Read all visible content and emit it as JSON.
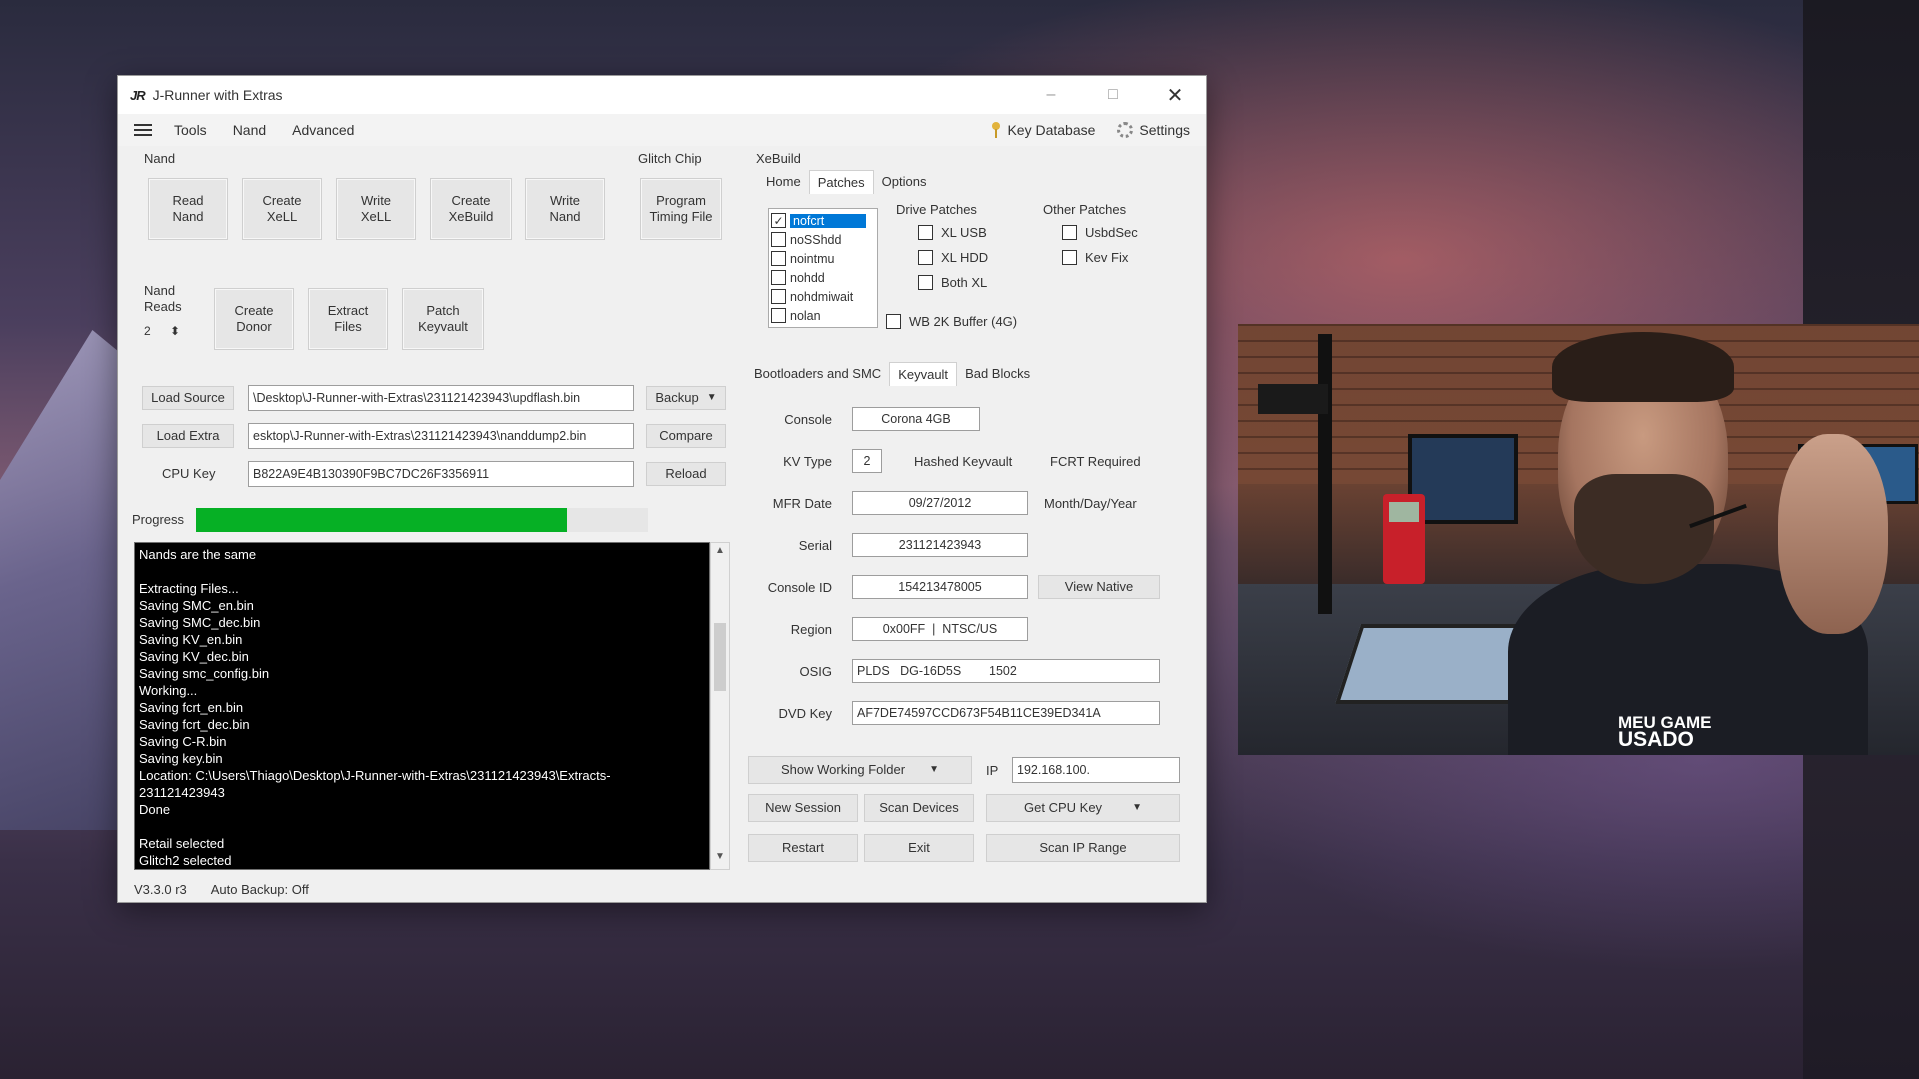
{
  "window": {
    "logo": "JR",
    "title": "J-Runner with Extras",
    "controls": [
      "–",
      "□",
      "✕"
    ]
  },
  "menu": {
    "items": [
      "Tools",
      "Nand",
      "Advanced"
    ],
    "key_database": "Key Database",
    "settings": "Settings"
  },
  "nand": {
    "group_label": "Nand",
    "buttons": [
      "Read\nNand",
      "Create\nXeLL",
      "Write\nXeLL",
      "Create\nXeBuild",
      "Write\nNand"
    ],
    "reads_label": "Nand\nReads",
    "reads_value": "2",
    "second_row": [
      "Create\nDonor",
      "Extract\nFiles",
      "Patch\nKeyvault"
    ]
  },
  "glitch_chip": {
    "label": "Glitch Chip",
    "button": "Program\nTiming File"
  },
  "files": {
    "load_source_label": "Load Source",
    "load_source_value": "\\Desktop\\J-Runner-with-Extras\\231121423943\\updflash.bin",
    "backup_label": "Backup",
    "load_extra_label": "Load Extra",
    "load_extra_value": "esktop\\J-Runner-with-Extras\\231121423943\\nanddump2.bin",
    "compare_label": "Compare",
    "cpu_key_label": "CPU Key",
    "cpu_key_value": "B822A9E4B130390F9BC7DC26F3356911",
    "reload_label": "Reload"
  },
  "progress": {
    "label": "Progress",
    "fraction": 0.82
  },
  "console_lines": [
    "Nands are the same",
    "",
    "Extracting Files...",
    "Saving SMC_en.bin",
    "Saving SMC_dec.bin",
    "Saving KV_en.bin",
    "Saving KV_dec.bin",
    "Saving smc_config.bin",
    "Working...",
    "Saving fcrt_en.bin",
    "Saving fcrt_dec.bin",
    "Saving C-R.bin",
    "Saving key.bin",
    "Location: C:\\Users\\Thiago\\Desktop\\J-Runner-with-Extras\\231121423943\\Extracts-",
    "231121423943",
    "Done",
    "",
    "Retail selected",
    "Glitch2 selected"
  ],
  "status": {
    "version": "V3.3.0 r3",
    "auto_backup": "Auto Backup: Off"
  },
  "xebuild": {
    "label": "XeBuild",
    "tabs": [
      "Home",
      "Patches",
      "Options"
    ],
    "active_tab": "Patches",
    "patch_list": [
      {
        "label": "nofcrt",
        "checked": true,
        "selected": true
      },
      {
        "label": "noSShdd",
        "checked": false,
        "selected": false
      },
      {
        "label": "nointmu",
        "checked": false,
        "selected": false
      },
      {
        "label": "nohdd",
        "checked": false,
        "selected": false
      },
      {
        "label": "nohdmiwait",
        "checked": false,
        "selected": false
      },
      {
        "label": "nolan",
        "checked": false,
        "selected": false
      }
    ],
    "drive_patches_label": "Drive Patches",
    "drive_patches": [
      "XL USB",
      "XL HDD",
      "Both XL"
    ],
    "other_patches_label": "Other Patches",
    "other_patches": [
      "UsbdSec",
      "Kev Fix"
    ],
    "wb_label": "WB 2K Buffer (4G)"
  },
  "info": {
    "tabs": [
      "Bootloaders and SMC",
      "Keyvault",
      "Bad Blocks"
    ],
    "active_tab": "Keyvault",
    "console_label": "Console",
    "console_value": "Corona 4GB",
    "kv_type_label": "KV Type",
    "kv_type_value": "2",
    "hashed_keyvault": "Hashed Keyvault",
    "fcrt_required": "FCRT Required",
    "mfr_date_label": "MFR Date",
    "mfr_date_value": "09/27/2012",
    "mfr_date_format": "Month/Day/Year",
    "serial_label": "Serial",
    "serial_value": "231121423943",
    "console_id_label": "Console ID",
    "console_id_value": "154213478005",
    "view_native": "View Native",
    "region_label": "Region",
    "region_value": "0x00FF  |  NTSC/US",
    "osig_label": "OSIG",
    "osig_value": "PLDS   DG-16D5S        1502",
    "dvd_key_label": "DVD Key",
    "dvd_key_value": "AF7DE74597CCD673F54B11CE39ED341A"
  },
  "actions": {
    "show_working_folder": "Show Working Folder",
    "ip_label": "IP",
    "ip_value": "192.168.100.",
    "new_session": "New Session",
    "scan_devices": "Scan Devices",
    "get_cpu_key": "Get CPU Key",
    "restart": "Restart",
    "exit": "Exit",
    "scan_ip_range": "Scan IP Range"
  },
  "webcam": {
    "shirt_line1": "MEU GAME",
    "shirt_line2": "USADO"
  },
  "colors": {
    "progress_fill": "#06b025",
    "selection": "#0078d7",
    "console_bg": "#000000"
  }
}
